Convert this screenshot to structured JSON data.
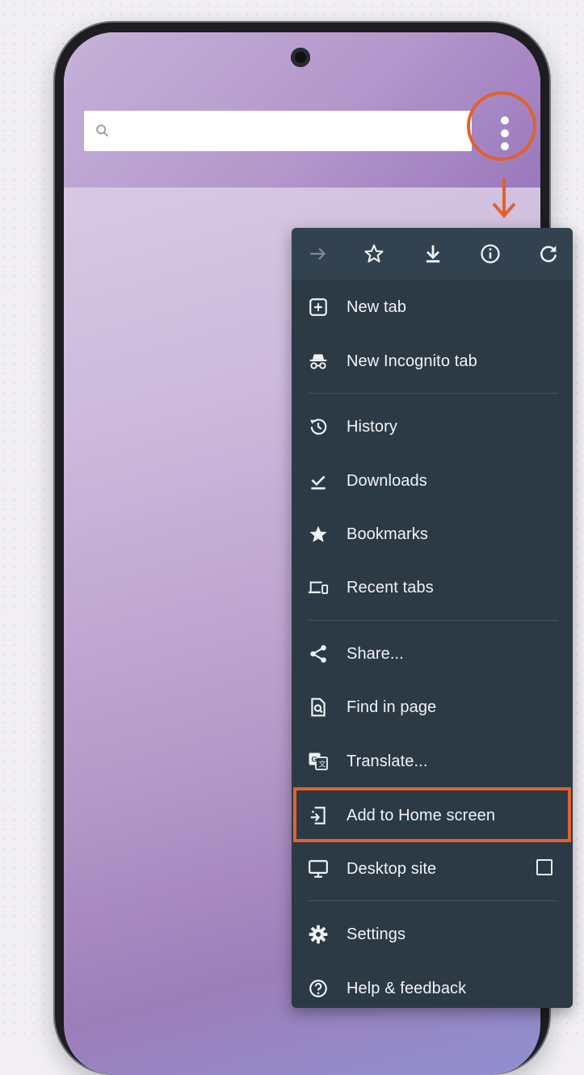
{
  "colors": {
    "menu_bg": "#2c3a45",
    "accent_highlight": "#e0622e",
    "menu_text": "#f0f3f6"
  },
  "toolbar": {
    "icons": [
      "forward-icon",
      "star-icon",
      "download-icon",
      "info-icon",
      "refresh-icon"
    ]
  },
  "menu": {
    "items": [
      {
        "label": "New tab",
        "icon": "plus-box-icon"
      },
      {
        "label": "New Incognito tab",
        "icon": "incognito-icon"
      },
      {
        "label": "History",
        "icon": "history-icon"
      },
      {
        "label": "Downloads",
        "icon": "download-check-icon"
      },
      {
        "label": "Bookmarks",
        "icon": "star-filled-icon"
      },
      {
        "label": "Recent tabs",
        "icon": "devices-icon"
      },
      {
        "label": "Share...",
        "icon": "share-icon"
      },
      {
        "label": "Find in page",
        "icon": "find-in-page-icon"
      },
      {
        "label": "Translate...",
        "icon": "translate-icon"
      },
      {
        "label": "Add to Home screen",
        "icon": "add-to-home-icon"
      },
      {
        "label": "Desktop site",
        "icon": "desktop-icon"
      },
      {
        "label": "Settings",
        "icon": "gear-icon"
      },
      {
        "label": "Help & feedback",
        "icon": "help-icon"
      }
    ]
  }
}
